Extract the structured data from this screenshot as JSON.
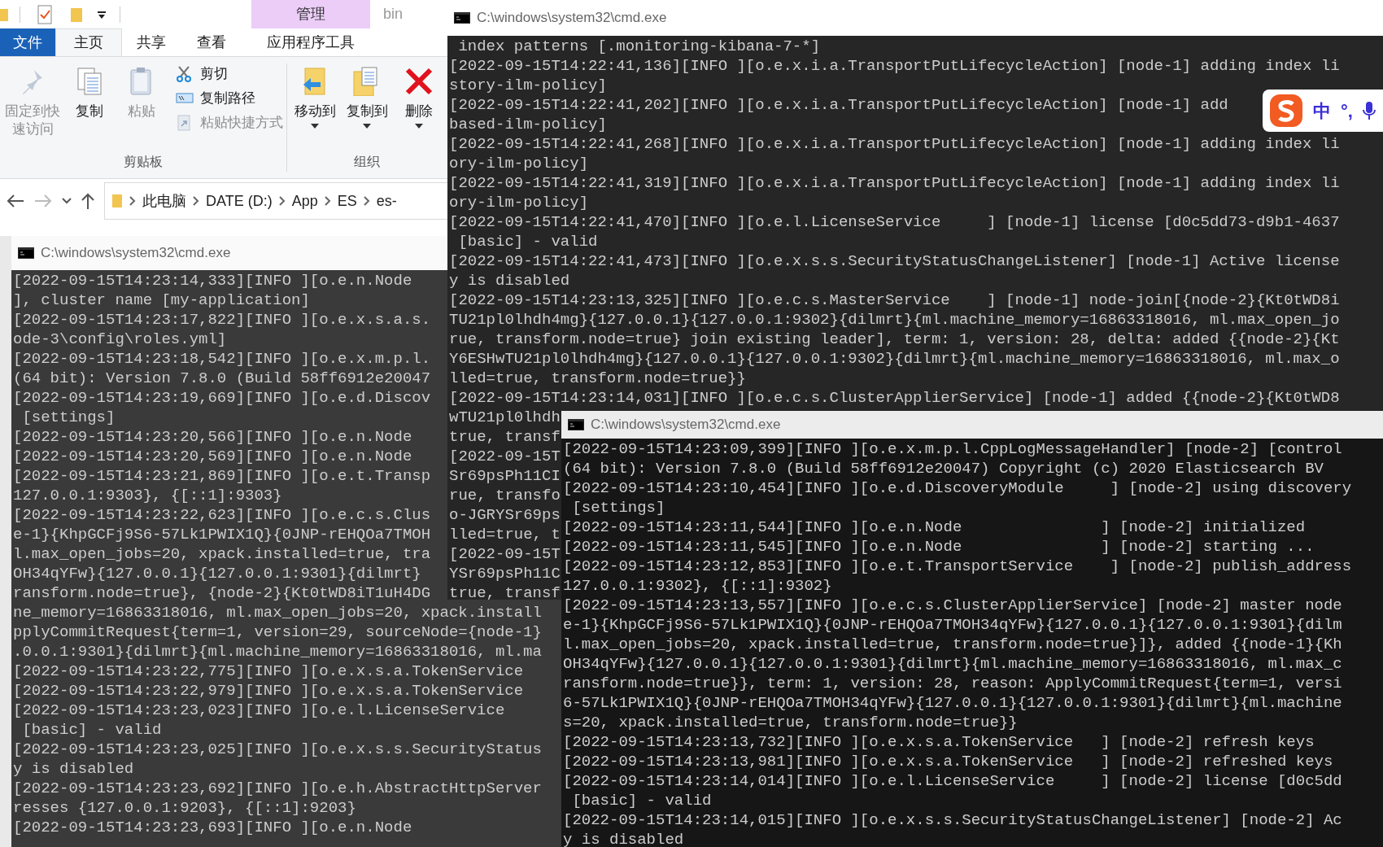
{
  "explorer": {
    "context_header": "管理",
    "title": "bin",
    "tabs": [
      {
        "label": "文件",
        "kind": "file",
        "selected": false
      },
      {
        "label": "主页",
        "kind": "tab",
        "selected": true
      },
      {
        "label": "共享",
        "kind": "tab",
        "selected": false
      },
      {
        "label": "查看",
        "kind": "tab",
        "selected": false
      },
      {
        "label": "应用程序工具",
        "kind": "context",
        "selected": false
      }
    ],
    "ribbon_groups": [
      {
        "label": "剪贴板",
        "commands": [
          {
            "label": "固定到快速访问",
            "kind": "large",
            "disabled": true
          },
          {
            "label": "复制",
            "kind": "large",
            "disabled": false
          },
          {
            "label": "粘贴",
            "kind": "large",
            "disabled": true
          },
          {
            "label": "剪切",
            "kind": "small",
            "disabled": false
          },
          {
            "label": "复制路径",
            "kind": "small",
            "disabled": false
          },
          {
            "label": "粘贴快捷方式",
            "kind": "small",
            "disabled": true
          }
        ]
      },
      {
        "label": "组织",
        "commands": [
          {
            "label": "移动到",
            "kind": "large",
            "disabled": false,
            "dropdown": true
          },
          {
            "label": "复制到",
            "kind": "large",
            "disabled": false,
            "dropdown": true
          },
          {
            "label": "删除",
            "kind": "large",
            "disabled": false,
            "dropdown": true
          }
        ]
      }
    ],
    "address": [
      "此电脑",
      "DATE (D:)",
      "App",
      "ES",
      "es-"
    ]
  },
  "consoles": [
    {
      "title": "C:\\windows\\system32\\cmd.exe",
      "lines": [
        " index patterns [.monitoring-kibana-7-*]",
        "[2022-09-15T14:22:41,136][INFO ][o.e.x.i.a.TransportPutLifecycleAction] [node-1] adding index li",
        "story-ilm-policy]",
        "[2022-09-15T14:22:41,202][INFO ][o.e.x.i.a.TransportPutLifecycleAction] [node-1] add",
        "based-ilm-policy]",
        "[2022-09-15T14:22:41,268][INFO ][o.e.x.i.a.TransportPutLifecycleAction] [node-1] adding index li",
        "ory-ilm-policy]",
        "[2022-09-15T14:22:41,319][INFO ][o.e.x.i.a.TransportPutLifecycleAction] [node-1] adding index li",
        "ory-ilm-policy]",
        "[2022-09-15T14:22:41,470][INFO ][o.e.l.LicenseService     ] [node-1] license [d0c5dd73-d9b1-4637",
        " [basic] - valid",
        "[2022-09-15T14:22:41,473][INFO ][o.e.x.s.s.SecurityStatusChangeListener] [node-1] Active license",
        "y is disabled",
        "[2022-09-15T14:23:13,325][INFO ][o.e.c.s.MasterService    ] [node-1] node-join[{node-2}{Kt0tWD8i",
        "TU21pl0lhdh4mg}{127.0.0.1}{127.0.0.1:9302}{dilmrt}{ml.machine_memory=16863318016, ml.max_open_jo",
        "rue, transform.node=true} join existing leader], term: 1, version: 28, delta: added {{node-2}{Kt",
        "Y6ESHwTU21pl0lhdh4mg}{127.0.0.1}{127.0.0.1:9302}{dilmrt}{ml.machine_memory=16863318016, ml.max_o",
        "lled=true, transform.node=true}}",
        "[2022-09-15T14:23:14,031][INFO ][o.e.c.s.ClusterApplierService] [node-1] added {{node-2}{Kt0tWD8",
        "wTU21pl0lhdh",
        "true, transf",
        "[2022-09-15T",
        "Sr69psPh11CI",
        "rue, transfo",
        "o-JGRYSr69ps",
        "lled=true, t",
        "[2022-09-15T",
        "YSr69psPh11C",
        "true, transf"
      ]
    },
    {
      "title": "C:\\windows\\system32\\cmd.exe",
      "lines": [
        "[2022-09-15T14:23:14,333][INFO ][o.e.n.Node",
        "], cluster name [my-application]",
        "[2022-09-15T14:23:17,822][INFO ][o.e.x.s.a.s.",
        "ode-3\\config\\roles.yml]",
        "[2022-09-15T14:23:18,542][INFO ][o.e.x.m.p.l.",
        "(64 bit): Version 7.8.0 (Build 58ff6912e20047",
        "[2022-09-15T14:23:19,669][INFO ][o.e.d.Discov",
        " [settings]",
        "[2022-09-15T14:23:20,566][INFO ][o.e.n.Node",
        "[2022-09-15T14:23:20,569][INFO ][o.e.n.Node",
        "[2022-09-15T14:23:21,869][INFO ][o.e.t.Transp",
        "127.0.0.1:9303}, {[::1]:9303}",
        "[2022-09-15T14:23:22,623][INFO ][o.e.c.s.Clus",
        "e-1}{KhpGCFj9S6-57Lk1PWIX1Q}{0JNP-rEHQOa7TMOH",
        "l.max_open_jobs=20, xpack.installed=true, tra",
        "OH34qYFw}{127.0.0.1}{127.0.0.1:9301}{dilmrt}",
        "ransform.node=true}, {node-2}{Kt0tWD8iT1uH4DG",
        "ne_memory=16863318016, ml.max_open_jobs=20, xpack.install",
        "pplyCommitRequest{term=1, version=29, sourceNode={node-1}",
        ".0.0.1:9301}{dilmrt}{ml.machine_memory=16863318016, ml.ma",
        "[2022-09-15T14:23:22,775][INFO ][o.e.x.s.a.TokenService",
        "[2022-09-15T14:23:22,979][INFO ][o.e.x.s.a.TokenService",
        "[2022-09-15T14:23:23,023][INFO ][o.e.l.LicenseService",
        " [basic] - valid",
        "[2022-09-15T14:23:23,025][INFO ][o.e.x.s.s.SecurityStatus",
        "y is disabled",
        "[2022-09-15T14:23:23,692][INFO ][o.e.h.AbstractHttpServer",
        "resses {127.0.0.1:9203}, {[::1]:9203}",
        "[2022-09-15T14:23:23,693][INFO ][o.e.n.Node"
      ]
    },
    {
      "title": "C:\\windows\\system32\\cmd.exe",
      "lines": [
        "[2022-09-15T14:23:09,399][INFO ][o.e.x.m.p.l.CppLogMessageHandler] [node-2] [control",
        "(64 bit): Version 7.8.0 (Build 58ff6912e20047) Copyright (c) 2020 Elasticsearch BV",
        "[2022-09-15T14:23:10,454][INFO ][o.e.d.DiscoveryModule     ] [node-2] using discovery",
        " [settings]",
        "[2022-09-15T14:23:11,544][INFO ][o.e.n.Node               ] [node-2] initialized",
        "[2022-09-15T14:23:11,545][INFO ][o.e.n.Node               ] [node-2] starting ...",
        "[2022-09-15T14:23:12,853][INFO ][o.e.t.TransportService    ] [node-2] publish_address",
        "127.0.0.1:9302}, {[::1]:9302}",
        "[2022-09-15T14:23:13,557][INFO ][o.e.c.s.ClusterApplierService] [node-2] master node",
        "e-1}{KhpGCFj9S6-57Lk1PWIX1Q}{0JNP-rEHQOa7TMOH34qYFw}{127.0.0.1}{127.0.0.1:9301}{dilm",
        "l.max_open_jobs=20, xpack.installed=true, transform.node=true}]}, added {{node-1}{Kh",
        "OH34qYFw}{127.0.0.1}{127.0.0.1:9301}{dilmrt}{ml.machine_memory=16863318016, ml.max_c",
        "ransform.node=true}}, term: 1, version: 28, reason: ApplyCommitRequest{term=1, versi",
        "6-57Lk1PWIX1Q}{0JNP-rEHQOa7TMOH34qYFw}{127.0.0.1}{127.0.0.1:9301}{dilmrt}{ml.machine",
        "s=20, xpack.installed=true, transform.node=true}}",
        "[2022-09-15T14:23:13,732][INFO ][o.e.x.s.a.TokenService   ] [node-2] refresh keys",
        "[2022-09-15T14:23:13,981][INFO ][o.e.x.s.a.TokenService   ] [node-2] refreshed keys",
        "[2022-09-15T14:23:14,014][INFO ][o.e.l.LicenseService     ] [node-2] license [d0c5dd",
        " [basic] - valid",
        "[2022-09-15T14:23:14,015][INFO ][o.e.x.s.s.SecurityStatusChangeListener] [node-2] Ac",
        "y is disabled"
      ]
    }
  ],
  "ime": {
    "labels": [
      "中",
      "°,"
    ]
  }
}
